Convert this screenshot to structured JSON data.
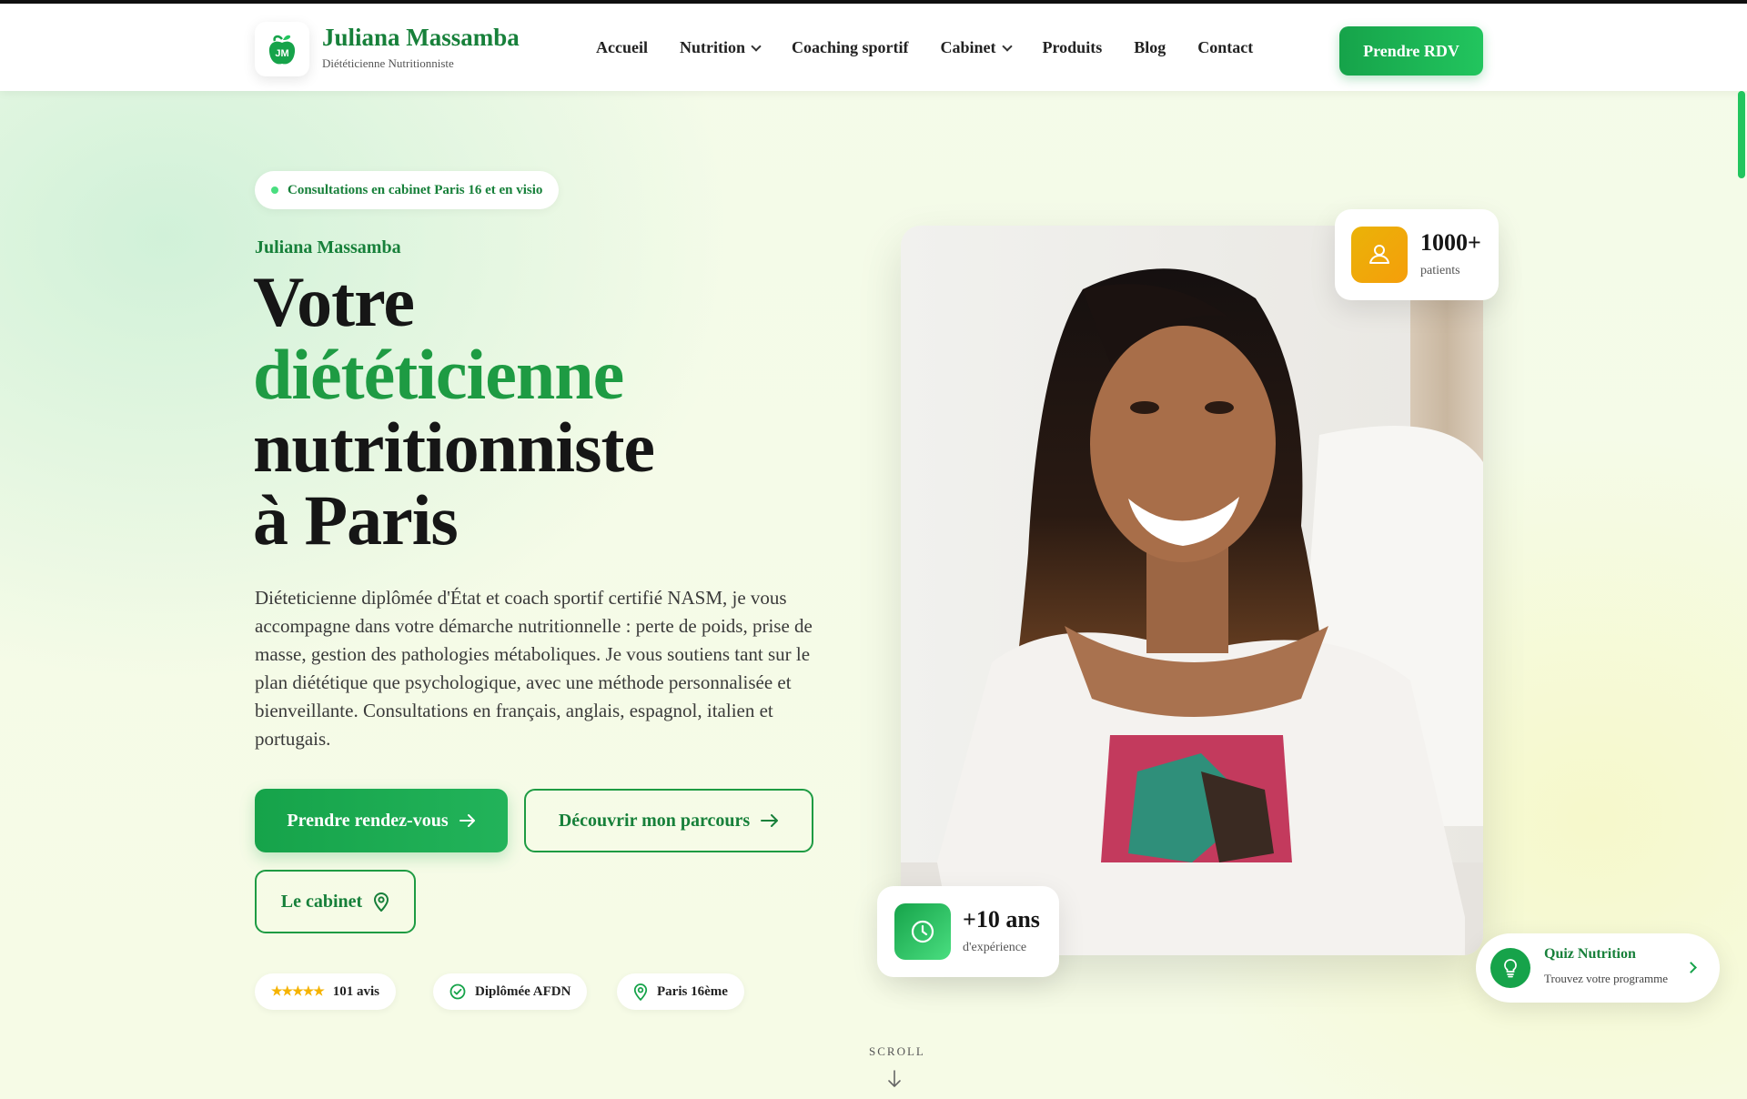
{
  "header": {
    "logo_initials": "JM",
    "brand_name": "Juliana Massamba",
    "brand_subtitle": "Diététicienne Nutritionniste",
    "nav": [
      {
        "label": "Accueil",
        "dropdown": false
      },
      {
        "label": "Nutrition",
        "dropdown": true
      },
      {
        "label": "Coaching sportif",
        "dropdown": false
      },
      {
        "label": "Cabinet",
        "dropdown": true
      },
      {
        "label": "Produits",
        "dropdown": false
      },
      {
        "label": "Blog",
        "dropdown": false
      },
      {
        "label": "Contact",
        "dropdown": false
      }
    ],
    "cta_label": "Prendre RDV"
  },
  "hero": {
    "pill_text": "Consultations en cabinet Paris 16 et en visio",
    "eyebrow": "Juliana Massamba",
    "title_line1": "Votre",
    "title_line2": "diététicienne",
    "title_line3": "nutritionniste",
    "title_line4": "à Paris",
    "lead": "Diéteticienne diplômée d'État et coach sportif certifié NASM, je vous accompagne dans votre démarche nutritionnelle : perte de poids, prise de masse, gestion des pathologies métaboliques. Je vous soutiens tant sur le plan diététique que psychologique, avec une méthode personnalisée et bienveillante. Consultations en français, anglais, espagnol, italien et portugais.",
    "buttons": {
      "primary": "Prendre rendez-vous",
      "secondary": "Découvrir mon parcours",
      "tertiary": "Le cabinet"
    },
    "badges": {
      "reviews": "101 avis",
      "rating_stars": "★★★★★",
      "diploma": "Diplômée AFDN",
      "location": "Paris 16ème"
    },
    "scroll_label": "SCROLL"
  },
  "stats": {
    "patients_value": "1000+",
    "patients_label": "patients",
    "experience_value": "+10 ans",
    "experience_label": "d'expérience"
  },
  "quiz": {
    "title": "Quiz Nutrition",
    "subtitle": "Trouvez votre programme"
  },
  "colors": {
    "brand_green": "#17803a",
    "accent_green": "#22c55e",
    "amber": "#f5b301"
  }
}
